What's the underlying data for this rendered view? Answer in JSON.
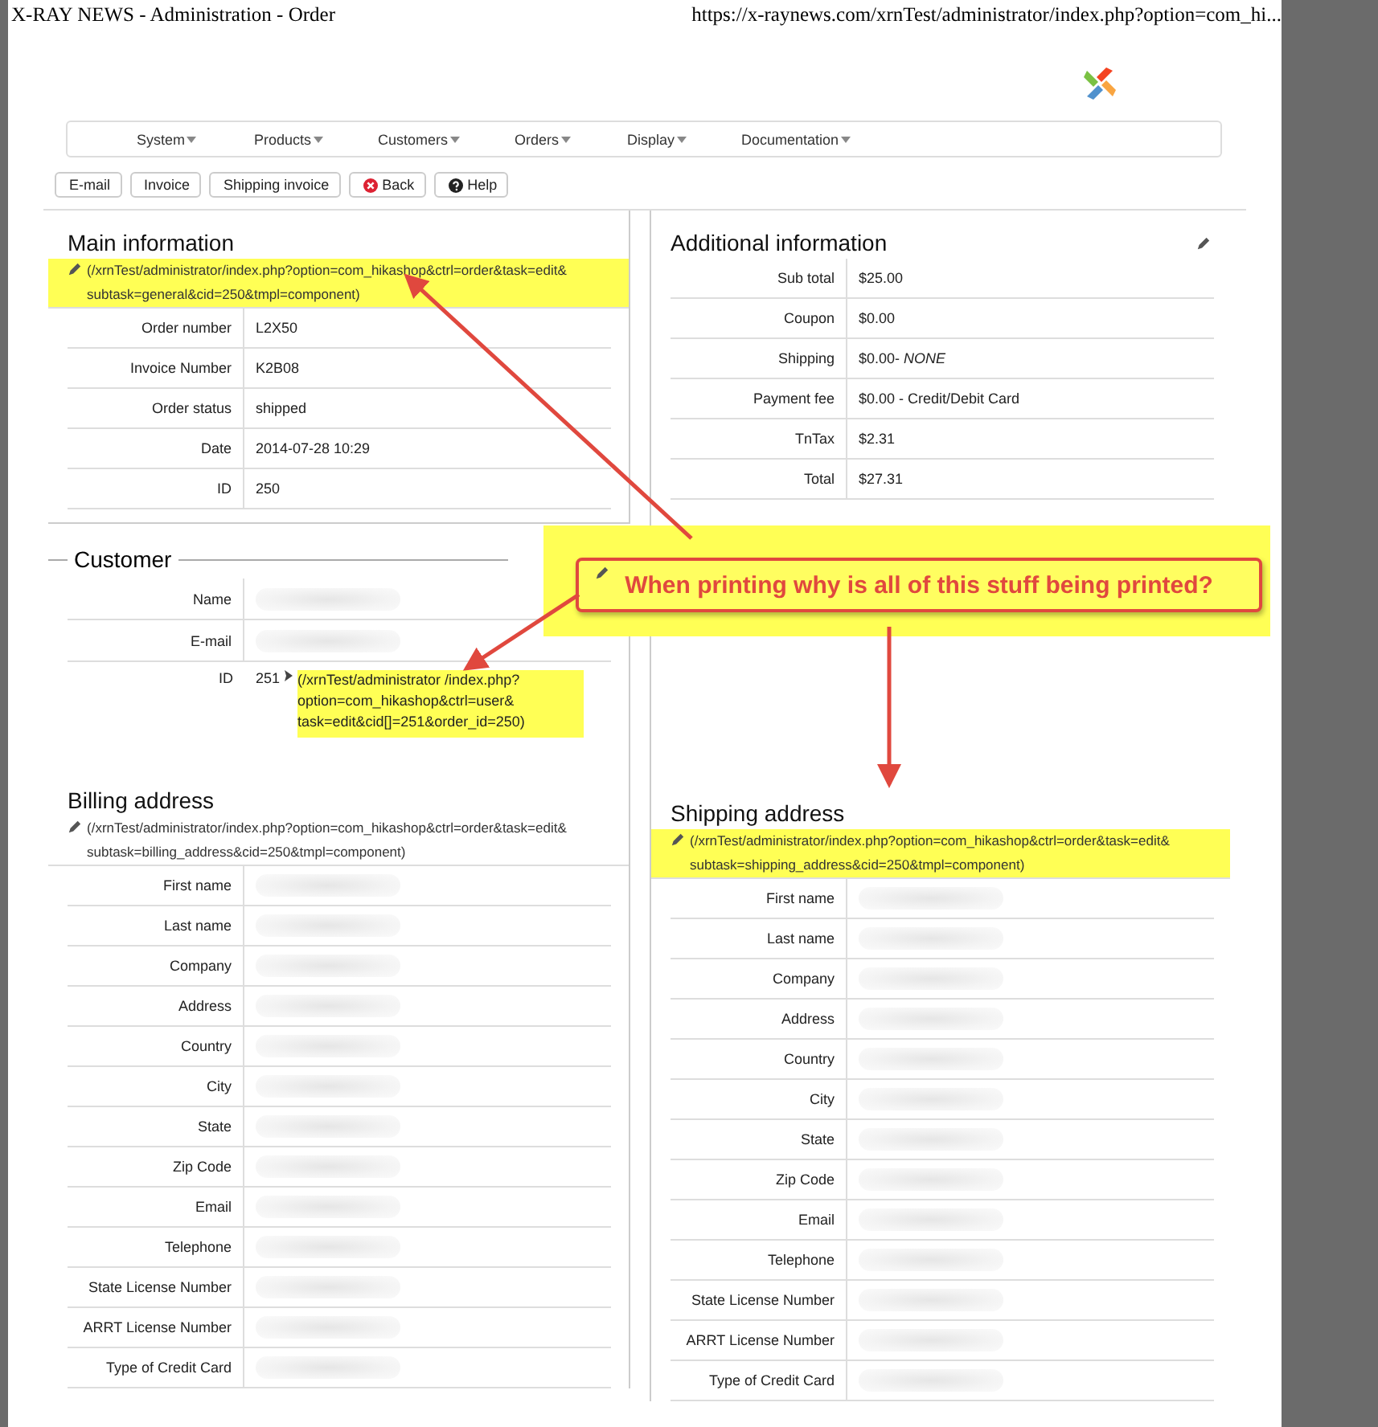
{
  "window": {
    "title": "X-RAY NEWS - Administration - Order",
    "url": "https://x-raynews.com/xrnTest/administrator/index.php?option=com_hi..."
  },
  "menu": [
    {
      "label": "System"
    },
    {
      "label": "Products"
    },
    {
      "label": "Customers"
    },
    {
      "label": "Orders"
    },
    {
      "label": "Display"
    },
    {
      "label": "Documentation"
    }
  ],
  "toolbar": [
    {
      "label": "E-mail",
      "kind": "plain"
    },
    {
      "label": "Invoice",
      "kind": "plain"
    },
    {
      "label": "Shipping invoice",
      "kind": "plain"
    },
    {
      "label": "Back",
      "kind": "back"
    },
    {
      "label": "Help",
      "kind": "help"
    }
  ],
  "main_information": {
    "title": "Main information",
    "link": {
      "text": "(/xrnTest/administrator/index.php?option=com_hikashop&ctrl=order&task=edit& subtask=general&cid=250&tmpl=component)",
      "highlighted": true
    },
    "rows": [
      {
        "label": "Order number",
        "value": "L2X50"
      },
      {
        "label": "Invoice Number",
        "value": "K2B08"
      },
      {
        "label": "Order status",
        "value": "shipped"
      },
      {
        "label": "Date",
        "value": "2014-07-28 10:29"
      },
      {
        "label": "ID",
        "value": "250"
      }
    ]
  },
  "additional_information": {
    "title": "Additional information",
    "rows": [
      {
        "label": "Sub total",
        "value": "$25.00"
      },
      {
        "label": "Coupon",
        "value": "$0.00"
      },
      {
        "label": "Shipping",
        "value": "$0.00- *NONE*"
      },
      {
        "label": "Payment fee",
        "value": "$0.00 - Credit/Debit Card"
      },
      {
        "label": "TnTax",
        "value": "$2.31"
      },
      {
        "label": "Total",
        "value": "$27.31"
      }
    ]
  },
  "customer": {
    "title": "Customer",
    "rows": [
      {
        "label": "Name",
        "kind": "redacted"
      },
      {
        "label": "E-mail",
        "kind": "redacted"
      },
      {
        "label": "ID",
        "kind": "link",
        "value": "251",
        "link": {
          "text": "(/xrnTest/administrator /index.php?option=com_hikashop&ctrl=user& task=edit&cid[]=251&order_id=250)",
          "highlighted": true
        }
      }
    ]
  },
  "billing_address": {
    "title": "Billing address",
    "link": {
      "text": "(/xrnTest/administrator/index.php?option=com_hikashop&ctrl=order&task=edit& subtask=billing_address&cid=250&tmpl=component)",
      "highlighted": false
    },
    "rows": [
      {
        "label": "First name",
        "kind": "redacted"
      },
      {
        "label": "Last name",
        "kind": "redacted"
      },
      {
        "label": "Company",
        "kind": "redacted"
      },
      {
        "label": "Address",
        "kind": "redacted"
      },
      {
        "label": "Country",
        "kind": "redacted"
      },
      {
        "label": "City",
        "kind": "redacted"
      },
      {
        "label": "State",
        "kind": "redacted"
      },
      {
        "label": "Zip Code",
        "kind": "redacted"
      },
      {
        "label": "Email",
        "kind": "redacted"
      },
      {
        "label": "Telephone",
        "kind": "redacted"
      },
      {
        "label": "State License Number",
        "kind": "redacted"
      },
      {
        "label": "ARRT License Number",
        "kind": "redacted"
      },
      {
        "label": "Type of Credit Card",
        "kind": "redacted"
      }
    ]
  },
  "shipping_address": {
    "title": "Shipping address",
    "link": {
      "text": "(/xrnTest/administrator/index.php?option=com_hikashop&ctrl=order&task=edit& subtask=shipping_address&cid=250&tmpl=component)",
      "highlighted": true
    },
    "rows": [
      {
        "label": "First name",
        "kind": "redacted"
      },
      {
        "label": "Last name",
        "kind": "redacted"
      },
      {
        "label": "Company",
        "kind": "redacted"
      },
      {
        "label": "Address",
        "kind": "redacted"
      },
      {
        "label": "Country",
        "kind": "redacted"
      },
      {
        "label": "City",
        "kind": "redacted"
      },
      {
        "label": "State",
        "kind": "redacted"
      },
      {
        "label": "Zip Code",
        "kind": "redacted"
      },
      {
        "label": "Email",
        "kind": "redacted"
      },
      {
        "label": "Telephone",
        "kind": "redacted"
      },
      {
        "label": "State License Number",
        "kind": "redacted"
      },
      {
        "label": "ARRT License Number",
        "kind": "redacted"
      },
      {
        "label": "Type of Credit Card",
        "kind": "redacted"
      }
    ]
  },
  "annotation": {
    "text": "When printing why is all of this stuff being printed?"
  }
}
